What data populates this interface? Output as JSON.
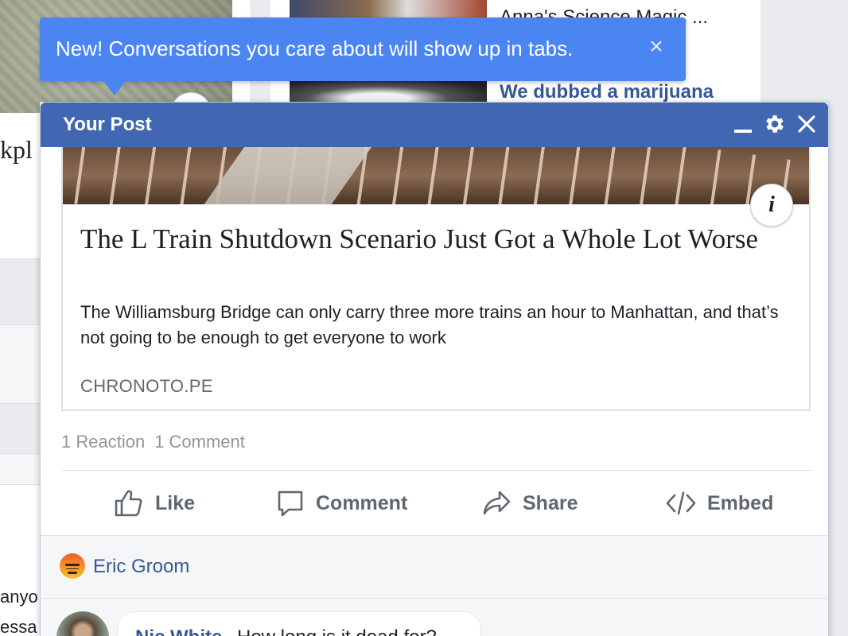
{
  "tooltip": {
    "text": "New! Conversations you care about will show up in tabs.",
    "close_symbol": "×"
  },
  "background": {
    "left_fragment": "kpl",
    "left_text_1": "anyo",
    "left_text_2": "essa",
    "right_headline_1": "Anna's Science Magic ...",
    "right_headline_2": "We dubbed a marijuana"
  },
  "post_window": {
    "title": "Your Post",
    "icons": [
      "minimize-icon",
      "gear-icon",
      "close-icon"
    ]
  },
  "link": {
    "info_symbol": "i",
    "headline": "The L Train Shutdown Scenario Just Got a Whole Lot Worse",
    "description": "The Williamsburg Bridge can only carry three more trains an hour to Manhattan, and that’s not going to be enough to get everyone to work",
    "domain": "CHRONOTO.PE"
  },
  "stats": {
    "reactions": "1 Reaction",
    "comments": "1 Comment"
  },
  "actions": {
    "like": "Like",
    "comment": "Comment",
    "share": "Share",
    "embed": "Embed"
  },
  "reactors": {
    "name": "Eric Groom",
    "emoji": "angry-reaction-icon"
  },
  "comment": {
    "author": "Nic White",
    "text": "How long is it dead for?"
  },
  "colors": {
    "tooltip_bg": "#4b85f2",
    "header_bg": "#4267b2",
    "link_color": "#365899"
  }
}
